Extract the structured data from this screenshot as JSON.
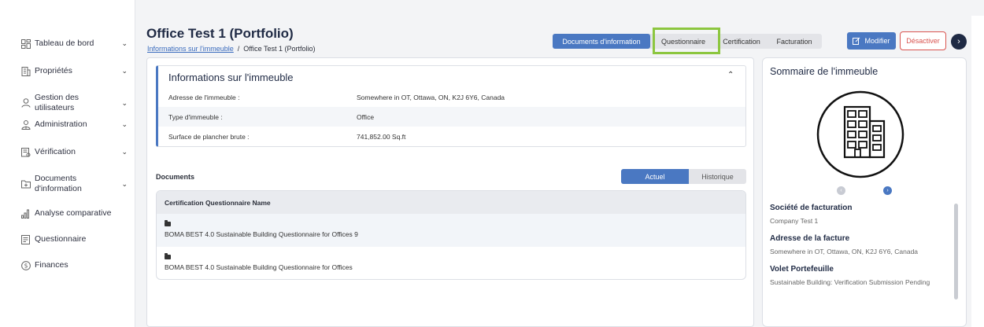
{
  "sidebar": {
    "items": [
      {
        "label": "Tableau de bord",
        "icon": "dashboard-icon",
        "has_chevron": true
      },
      {
        "label": "Propriétés",
        "icon": "building-icon",
        "has_chevron": true
      },
      {
        "label": "Gestion des utilisateurs",
        "icon": "user-icon",
        "has_chevron": true
      },
      {
        "label": "Administration",
        "icon": "admin-user-icon",
        "has_chevron": true
      },
      {
        "label": "Vérification",
        "icon": "verification-icon",
        "has_chevron": true
      },
      {
        "label": "Documents d'information",
        "icon": "document-folder-icon",
        "has_chevron": true
      },
      {
        "label": "Analyse comparative",
        "icon": "bar-chart-icon",
        "has_chevron": false
      },
      {
        "label": "Questionnaire",
        "icon": "questionnaire-icon",
        "has_chevron": false
      },
      {
        "label": "Finances",
        "icon": "dollar-icon",
        "has_chevron": false
      }
    ]
  },
  "header": {
    "title": "Office Test 1 (Portfolio)",
    "breadcrumb_link": "Informations sur l'immeuble",
    "breadcrumb_sep": "/",
    "breadcrumb_current": "Office Test 1 (Portfolio)",
    "tabs": [
      {
        "label": "Documents d'information",
        "active": true
      },
      {
        "label": "Questionnaire",
        "active": false
      },
      {
        "label": "Certification",
        "active": false
      },
      {
        "label": "Facturation",
        "active": false
      }
    ],
    "modify_label": "Modifier",
    "deactivate_label": "Désactiver"
  },
  "building_info": {
    "title": "Informations sur l'immeuble",
    "rows": [
      {
        "key": "Adresse de l'immeuble :",
        "value": "Somewhere in OT, Ottawa, ON, K2J 6Y6, Canada"
      },
      {
        "key": "Type d'immeuble :",
        "value": "Office"
      },
      {
        "key": "Surface de plancher brute :",
        "value": "741,852.00 Sq.ft"
      }
    ]
  },
  "documents": {
    "label": "Documents",
    "toggle_current": "Actuel",
    "toggle_history": "Historique",
    "column_header": "Certification Questionnaire Name",
    "rows": [
      "BOMA BEST 4.0 Sustainable Building Questionnaire for Offices 9",
      "BOMA BEST 4.0 Sustainable Building Questionnaire for Offices"
    ]
  },
  "summary": {
    "title": "Sommaire de l'immeuble",
    "billing_company_label": "Société de facturation",
    "billing_company_value": "Company Test 1",
    "billing_address_label": "Adresse de la facture",
    "billing_address_value": "Somewhere in OT, Ottawa, ON, K2J 6Y6, Canada",
    "portfolio_label": "Volet Portefeuille",
    "portfolio_value": "Sustainable Building: Verification Submission Pending"
  },
  "colors": {
    "accent": "#4a78c2",
    "danger": "#d9534f",
    "highlight": "#8cc63f",
    "heading": "#1f2a44"
  }
}
